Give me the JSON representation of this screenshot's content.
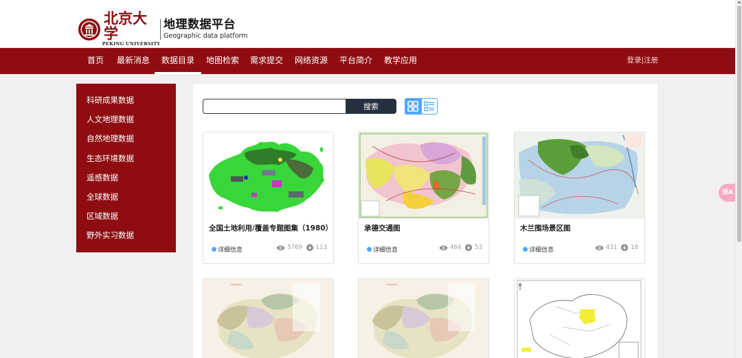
{
  "brand": {
    "university_cn": "北京大学",
    "university_en": "PEKING UNIVERSITY",
    "platform_cn": "地理数据平台",
    "platform_en": "Geographic data platform"
  },
  "nav": {
    "items": [
      "首页",
      "最新消息",
      "数据目录",
      "地图检索",
      "需求提交",
      "网络资源",
      "平台简介",
      "教学应用"
    ],
    "active": "数据目录",
    "login": "登录",
    "separator": "|",
    "register": "注册"
  },
  "sidebar": {
    "items": [
      "科研成果数据",
      "人文地理数据",
      "自然地理数据",
      "生态环境数据",
      "遥感数据",
      "全球数据",
      "区域数据",
      "野外实习数据"
    ]
  },
  "search": {
    "placeholder": "",
    "value": "",
    "button": "搜索"
  },
  "view": {
    "grid_icon": "grid-icon",
    "list_icon": "list-icon",
    "active": "grid"
  },
  "cards": [
    {
      "title": "全国土地利用/覆盖专题图集（1980）",
      "detail": "详细信息",
      "views": "5769",
      "downloads": "113"
    },
    {
      "title": "承德交通图",
      "detail": "详细信息",
      "views": "464",
      "downloads": "53"
    },
    {
      "title": "木兰围场景区图",
      "detail": "详细信息",
      "views": "431",
      "downloads": "18"
    },
    {
      "title": "",
      "detail": "",
      "views": "",
      "downloads": ""
    },
    {
      "title": "",
      "detail": "",
      "views": "",
      "downloads": ""
    },
    {
      "title": "",
      "detail": "",
      "views": "",
      "downloads": ""
    }
  ],
  "colors": {
    "brand_red": "#8f0d11",
    "accent_blue": "#4fa7ff",
    "search_button": "#25313f"
  },
  "floating_button": "译A"
}
